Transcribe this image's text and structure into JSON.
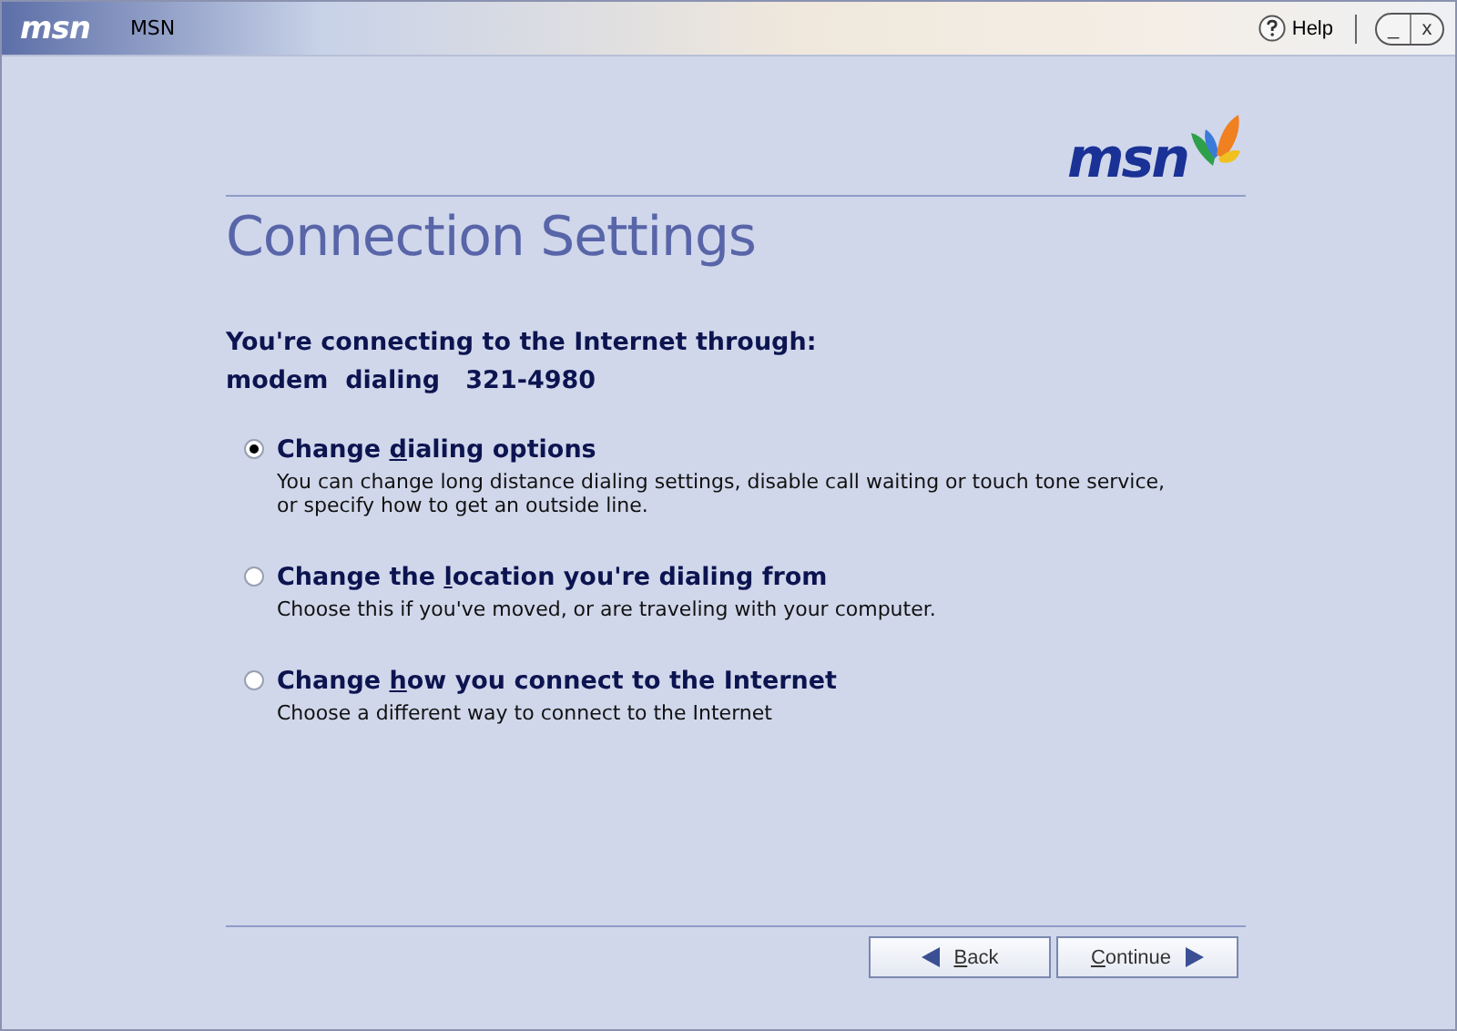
{
  "window": {
    "logo": "msn",
    "title": "MSN",
    "help": "Help",
    "minimize": "_",
    "close": "x"
  },
  "brand_logo": "msn",
  "heading": "Connection Settings",
  "connection": {
    "label": "You're connecting to the Internet through:",
    "method": "modem  dialing   321-4980"
  },
  "options": [
    {
      "label": {
        "before": "Change ",
        "key": "d",
        "after": "ialing options"
      },
      "description": "You can change long distance dialing settings, disable call waiting or touch tone service, or specify how to get an outside line.",
      "selected": true
    },
    {
      "label": {
        "before": "Change the ",
        "key": "l",
        "after": "ocation you're dialing from"
      },
      "description": "Choose this if you've moved, or are traveling with your computer.",
      "selected": false
    },
    {
      "label": {
        "before": "Change ",
        "key": "h",
        "after": "ow you connect to the Internet"
      },
      "description": "Choose a different way to connect to the Internet",
      "selected": false
    }
  ],
  "buttons": [
    {
      "kind": "back",
      "label": {
        "key": "B",
        "after": "ack"
      }
    },
    {
      "kind": "continue",
      "label": {
        "key": "C",
        "after": "ontinue"
      }
    }
  ]
}
